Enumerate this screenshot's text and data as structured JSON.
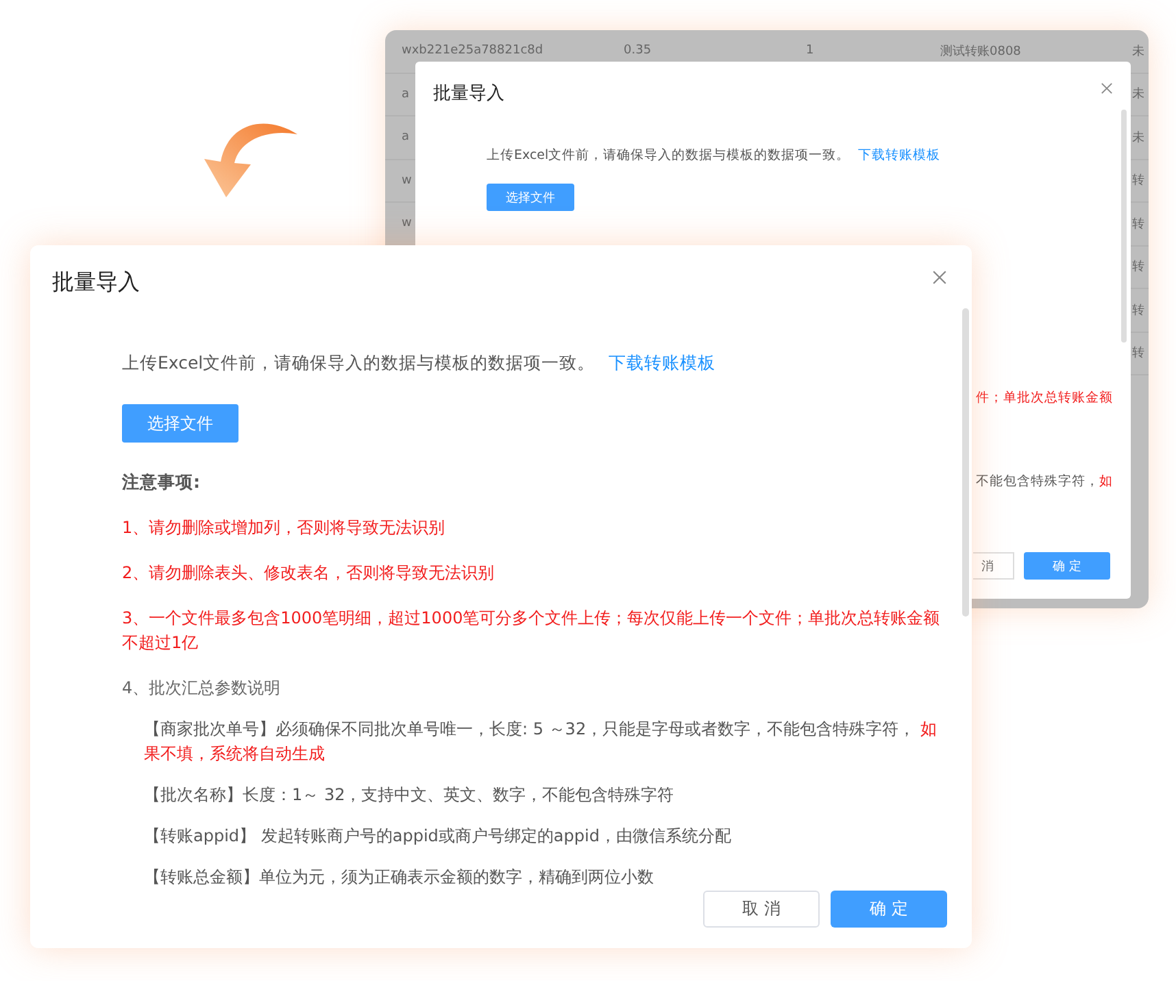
{
  "back_window": {
    "table_rows": [
      {
        "column_1": "wxb221e25a78821c8d",
        "column_2": "0.35",
        "column_3": "1",
        "column_4": "测试转账0808",
        "column_5": "未"
      },
      {
        "column_1": "a",
        "column_5": "未"
      },
      {
        "column_1": "a",
        "column_5": "未"
      },
      {
        "column_1": "w",
        "column_5": "转"
      },
      {
        "column_1": "w",
        "column_5": "转"
      },
      {
        "column_5": "转"
      },
      {
        "column_5": "转"
      },
      {
        "column_5": "转"
      }
    ],
    "dialog": {
      "title": "批量导入",
      "instruction": "上传Excel文件前，请确保导入的数据与模板的数据项一致。",
      "link": "下载转账模板",
      "file_button": "选择文件",
      "fragments": [
        {
          "note": "件；单批次总转账金额"
        },
        {
          "text": "不能包含特殊字符，",
          "note": "如"
        }
      ],
      "cancel_button": "消",
      "ok_button": "确 定"
    }
  },
  "dialog": {
    "title": "批量导入",
    "instruction": "上传Excel文件前，请确保导入的数据与模板的数据项一致。",
    "link": "下载转账模板",
    "file_button": "选择文件",
    "notes_title": "注意事项:",
    "notes": [
      {
        "kind": "warning",
        "text": "1、请勿删除或增加列，否则将导致无法识别"
      },
      {
        "kind": "warning",
        "text": "2、请勿删除表头、修改表名，否则将导致无法识别"
      },
      {
        "kind": "warning",
        "text": "3、一个文件最多包含1000笔明细，超过1000笔可分多个文件上传；每次仅能上传一个文件；单批次总转账金额不超过1亿"
      },
      {
        "kind": "normal",
        "text": "4、批次汇总参数说明",
        "children": [
          {
            "text": "【商家批次单号】必须确保不同批次单号唯一，长度: 5 ～32，只能是字母或者数字，不能包含特殊字符， ",
            "note": "如果不填，系统将自动生成"
          },
          {
            "text": "【批次名称】长度：1～ 32，支持中文、英文、数字，不能包含特殊字符"
          },
          {
            "text": "【转账appid】 发起转账商户号的appid或商户号绑定的appid，由微信系统分配"
          },
          {
            "text": "【转账总金额】单位为元，须为正确表示金额的数字，精确到两位小数"
          }
        ]
      }
    ],
    "cancel_button": "取 消",
    "ok_button": "确 定"
  }
}
